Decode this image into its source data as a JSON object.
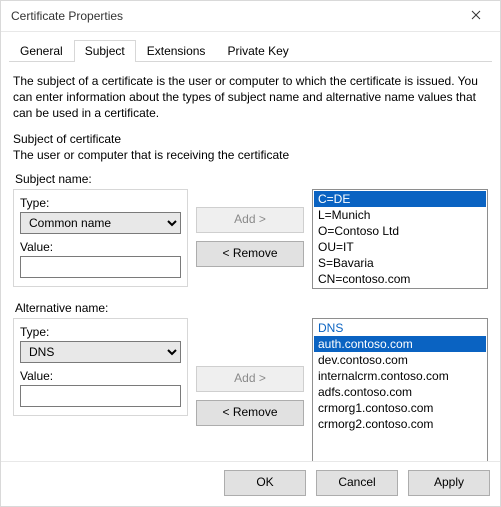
{
  "window": {
    "title": "Certificate Properties",
    "close_icon": "close"
  },
  "tabs": {
    "t0": "General",
    "t1": "Subject",
    "t2": "Extensions",
    "t3": "Private Key",
    "active": 1
  },
  "intro": "The subject of a certificate is the user or computer to which the certificate is issued. You can enter information about the types of subject name and alternative name values that can be used in a certificate.",
  "soc_heading": "Subject of certificate",
  "soc_sub": "The user or computer that is receiving the certificate",
  "subject": {
    "group_label": "Subject name:",
    "type_label": "Type:",
    "type_value": "Common name",
    "value_label": "Value:",
    "value_value": "",
    "add_label": "Add >",
    "remove_label": "< Remove",
    "list": {
      "i0": "C=DE",
      "i1": "L=Munich",
      "i2": "O=Contoso Ltd",
      "i3": "OU=IT",
      "i4": "S=Bavaria",
      "i5": "CN=contoso.com"
    },
    "selected_index": 0
  },
  "alt": {
    "group_label": "Alternative name:",
    "type_label": "Type:",
    "type_value": "DNS",
    "value_label": "Value:",
    "value_value": "",
    "add_label": "Add >",
    "remove_label": "< Remove",
    "list_heading": "DNS",
    "list": {
      "i0": "auth.contoso.com",
      "i1": "dev.contoso.com",
      "i2": "internalcrm.contoso.com",
      "i3": "adfs.contoso.com",
      "i4": "crmorg1.contoso.com",
      "i5": "crmorg2.contoso.com"
    },
    "selected_index": 0
  },
  "buttons": {
    "ok": "OK",
    "cancel": "Cancel",
    "apply": "Apply"
  }
}
